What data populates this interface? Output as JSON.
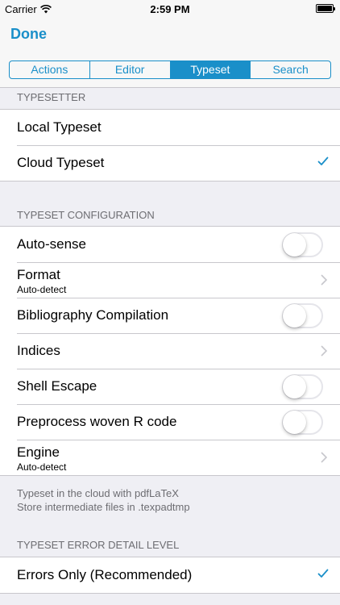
{
  "status_bar": {
    "carrier": "Carrier",
    "time": "2:59 PM"
  },
  "nav": {
    "done_label": "Done"
  },
  "segments": [
    "Actions",
    "Editor",
    "Typeset",
    "Search"
  ],
  "active_segment": "Typeset",
  "typesetter": {
    "header": "TYPESETTER",
    "rows": [
      {
        "label": "Local Typeset",
        "checked": false
      },
      {
        "label": "Cloud Typeset",
        "checked": true
      }
    ]
  },
  "config": {
    "header": "TYPESET CONFIGURATION",
    "rows": [
      {
        "label": "Auto-sense",
        "accessory": "toggle",
        "on": false
      },
      {
        "label": "Format",
        "sub": "Auto-detect",
        "accessory": "chevron"
      },
      {
        "label": "Bibliography Compilation",
        "accessory": "toggle",
        "on": false
      },
      {
        "label": "Indices",
        "accessory": "chevron"
      },
      {
        "label": "Shell Escape",
        "accessory": "toggle",
        "on": false
      },
      {
        "label": "Preprocess woven R code",
        "accessory": "toggle",
        "on": false
      },
      {
        "label": "Engine",
        "sub": "Auto-detect",
        "accessory": "chevron"
      }
    ],
    "footer_line1": "Typeset in the cloud with pdfLaTeX",
    "footer_line2": "Store intermediate files in .texpadtmp"
  },
  "error_level": {
    "header": "TYPESET ERROR DETAIL LEVEL",
    "rows": [
      {
        "label": "Errors Only (Recommended)",
        "checked": true
      }
    ]
  },
  "colors": {
    "accent": "#1a8fc9",
    "background": "#efeff4",
    "separator": "#c8c7cc"
  },
  "icons": [
    "wifi-icon",
    "battery-icon",
    "checkmark-icon",
    "chevron-right-icon"
  ]
}
